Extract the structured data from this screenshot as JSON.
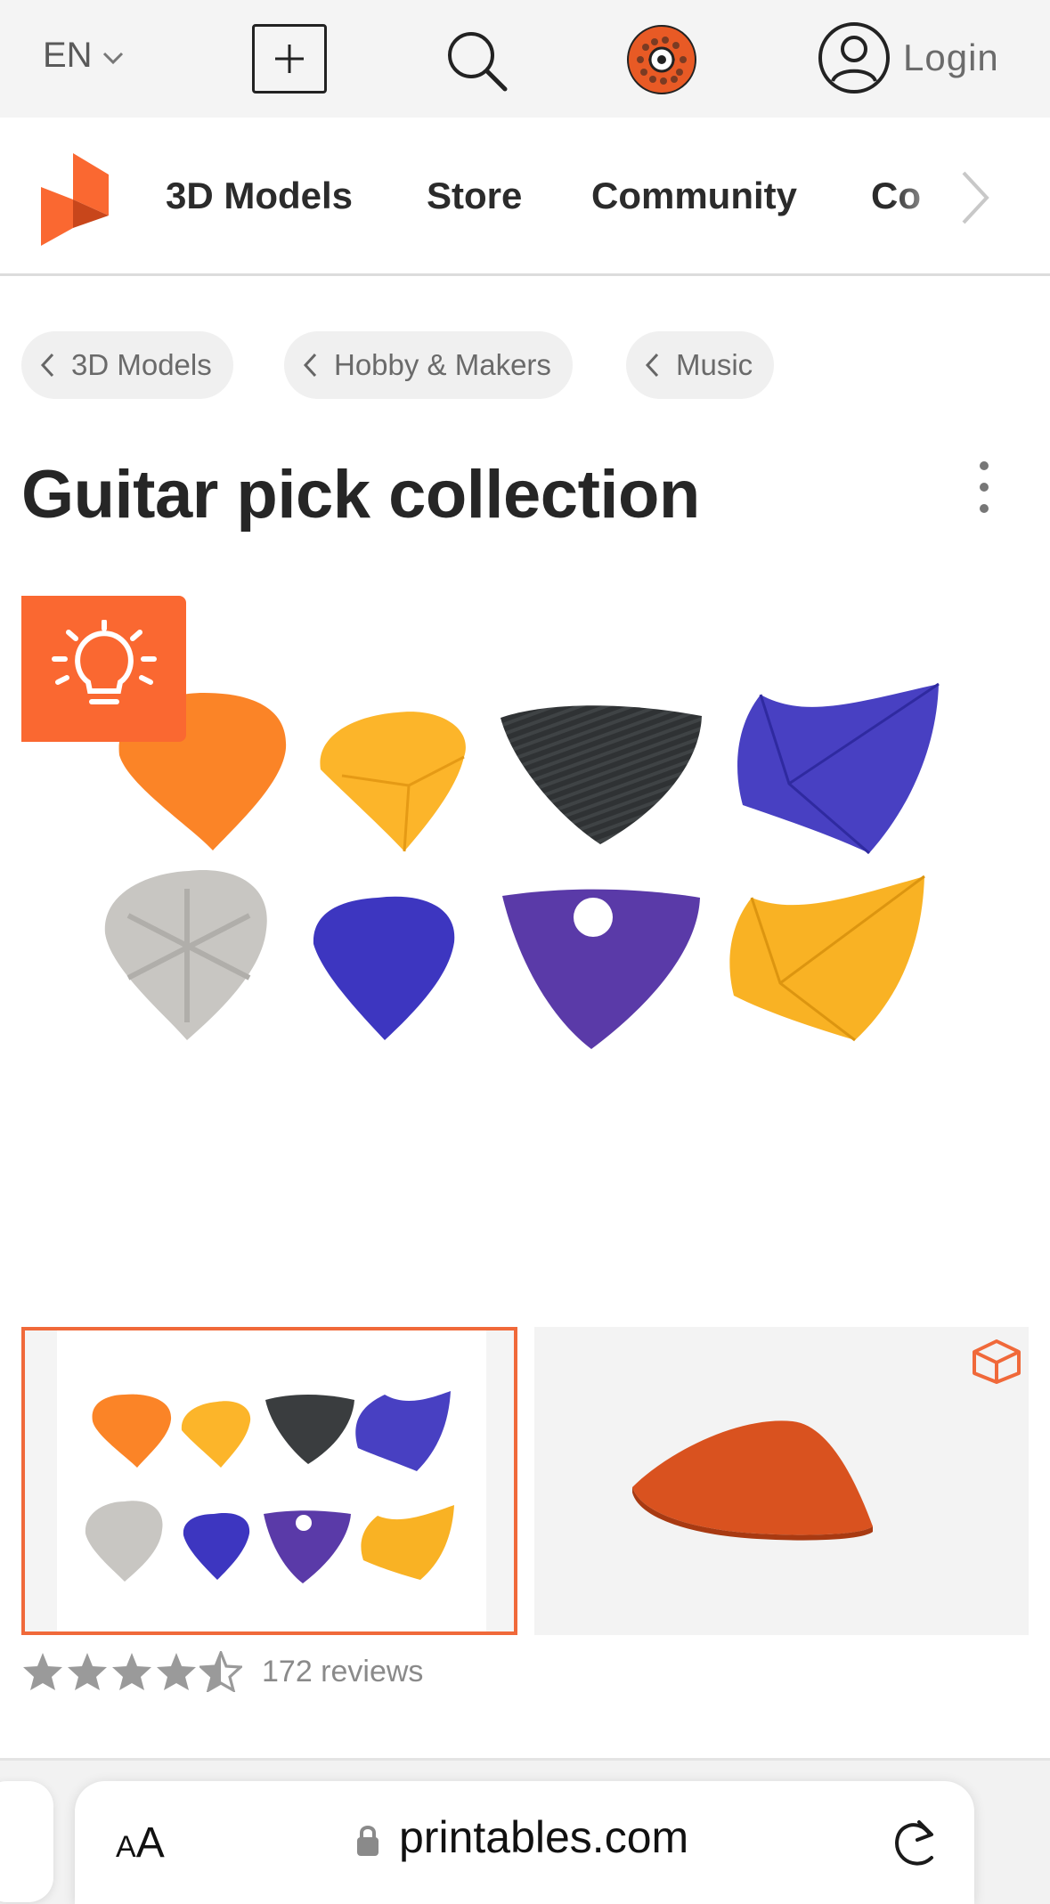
{
  "topbar": {
    "language": "EN",
    "login_label": "Login",
    "icons": [
      "chevron-down-icon",
      "plus-icon",
      "search-icon",
      "filament-spool-icon",
      "user-icon"
    ]
  },
  "nav": {
    "items": [
      "3D Models",
      "Store",
      "Community",
      "Co"
    ],
    "brand_color": "#fa6831"
  },
  "breadcrumbs": [
    "3D Models",
    "Hobby & Makers",
    "Music"
  ],
  "model": {
    "title": "Guitar pick collection",
    "rating_stars": 4.5,
    "rating_max": 5,
    "reviews_label": "172 reviews"
  },
  "gallery": {
    "selected_index": 0,
    "pick_colors": [
      "#fb8427",
      "#fcb52a",
      "#3a3d3f",
      "#4840c2",
      "#c8c6c2",
      "#3d36c0",
      "#5a3aa8",
      "#f9b224"
    ]
  },
  "browser": {
    "text_size_label_small": "A",
    "text_size_label_large": "A",
    "url": "printables.com"
  }
}
